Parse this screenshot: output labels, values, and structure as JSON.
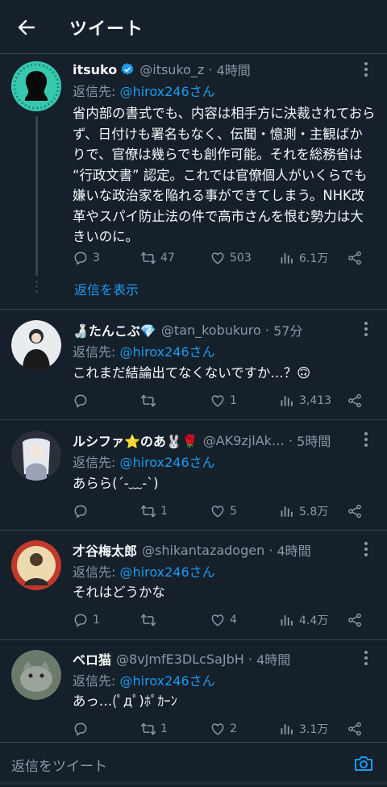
{
  "header": {
    "title": "ツイート"
  },
  "main_tweet": {
    "name": "itsuko",
    "handle": "@itsuko_z",
    "time": "4時間",
    "reply_prefix": "返信先:",
    "reply_target": "@hirox246さん",
    "text": "省内部の書式でも、内容は相手方に決裁されておらず、日付けも署名もなく、伝聞・憶測・主観ばかりで、官僚は幾らでも創作可能。それを総務省は “行政文書” 認定。これでは官僚個人がいくらでも嫌いな政治家を陥れる事ができてしまう。NHK改革やスパイ防止法の件で高市さんを恨む勢力は大きいのに。",
    "replies": "3",
    "retweets": "47",
    "likes": "503",
    "views": "6.1万",
    "show_replies": "返信を表示"
  },
  "replies": [
    {
      "name": "🍶たんこぶ💎",
      "handle": "@tan_kobukuro",
      "time": "57分",
      "reply_prefix": "返信先:",
      "reply_target": "@hirox246さん",
      "text": "これまだ結論出てなくないですか…？🙃",
      "replies": "",
      "retweets": "",
      "likes": "1",
      "views": "3,413"
    },
    {
      "name": "ルシファ⭐のあ🐰🌹",
      "handle": "@AK9zjlAk…",
      "time": "5時間",
      "reply_prefix": "返信先:",
      "reply_target": "@hirox246さん",
      "text": "あらら(´‐﹏‐`)",
      "replies": "",
      "retweets": "1",
      "likes": "5",
      "views": "5.8万"
    },
    {
      "name": "才谷梅太郎",
      "handle": "@shikantazadogen",
      "time": "4時間",
      "reply_prefix": "返信先:",
      "reply_target": "@hirox246さん",
      "text": "それはどうかな",
      "replies": "1",
      "retweets": "",
      "likes": "4",
      "views": "4.4万"
    },
    {
      "name": "ベロ猫",
      "handle": "@8vJmfE3DLcSaJbH",
      "time": "4時間",
      "reply_prefix": "返信先:",
      "reply_target": "@hirox246さん",
      "text": "あっ…(ﾟдﾟ)ﾎﾟｶｰﾝ",
      "replies": "",
      "retweets": "1",
      "likes": "2",
      "views": "3.1万"
    }
  ],
  "composer": {
    "placeholder": "返信をツイート"
  },
  "colors": {
    "background": "#15202b",
    "accent": "#1d9bf0",
    "muted": "#8b98a5",
    "divider": "#38444d"
  }
}
